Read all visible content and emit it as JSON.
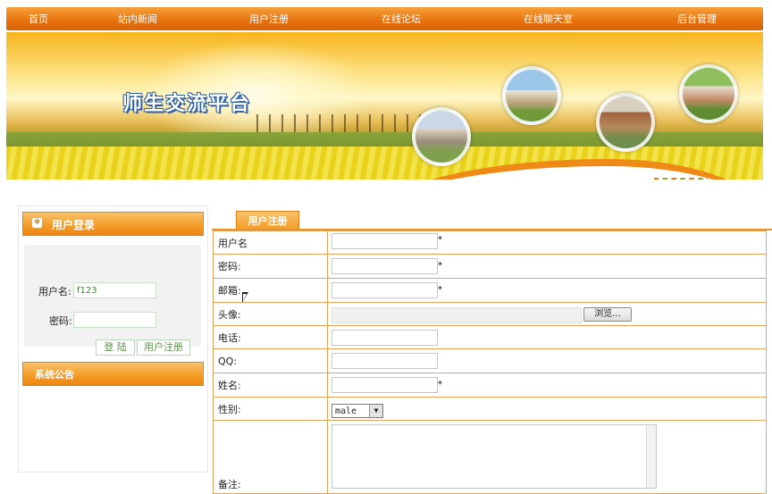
{
  "nav": {
    "items": [
      "首页",
      "站内新闻",
      "用户注册",
      "在线论坛",
      "在线聊天室",
      "后台管理"
    ]
  },
  "banner": {
    "title": "师生交流平台"
  },
  "login_panel": {
    "header": "用户登录",
    "username_label": "用户名:",
    "username_value": "f123",
    "password_label": "密码:",
    "password_value": "",
    "login_button": "登 陆",
    "register_button": "用户注册"
  },
  "notice_panel": {
    "header": "系统公告"
  },
  "register_form": {
    "tab_label": "用户注册",
    "fields": {
      "username": {
        "label": "用户名",
        "value": "",
        "required_mark": "*"
      },
      "password": {
        "label": "密码:",
        "value": "",
        "required_mark": "*"
      },
      "email": {
        "label": "邮箱:",
        "value": "",
        "required_mark": "*"
      },
      "avatar": {
        "label": "头像:",
        "browse_label": "浏览..."
      },
      "phone": {
        "label": "电话:",
        "value": ""
      },
      "qq": {
        "label": "QQ:",
        "value": ""
      },
      "name": {
        "label": "姓名:",
        "value": "",
        "required_mark": "*"
      },
      "gender": {
        "label": "性别:",
        "selected": "male"
      },
      "remark": {
        "label": "备注:",
        "value": ""
      }
    }
  },
  "colors": {
    "nav_orange": "#e8730e",
    "panel_orange": "#f39a24",
    "border_orange": "#e2a25c"
  }
}
